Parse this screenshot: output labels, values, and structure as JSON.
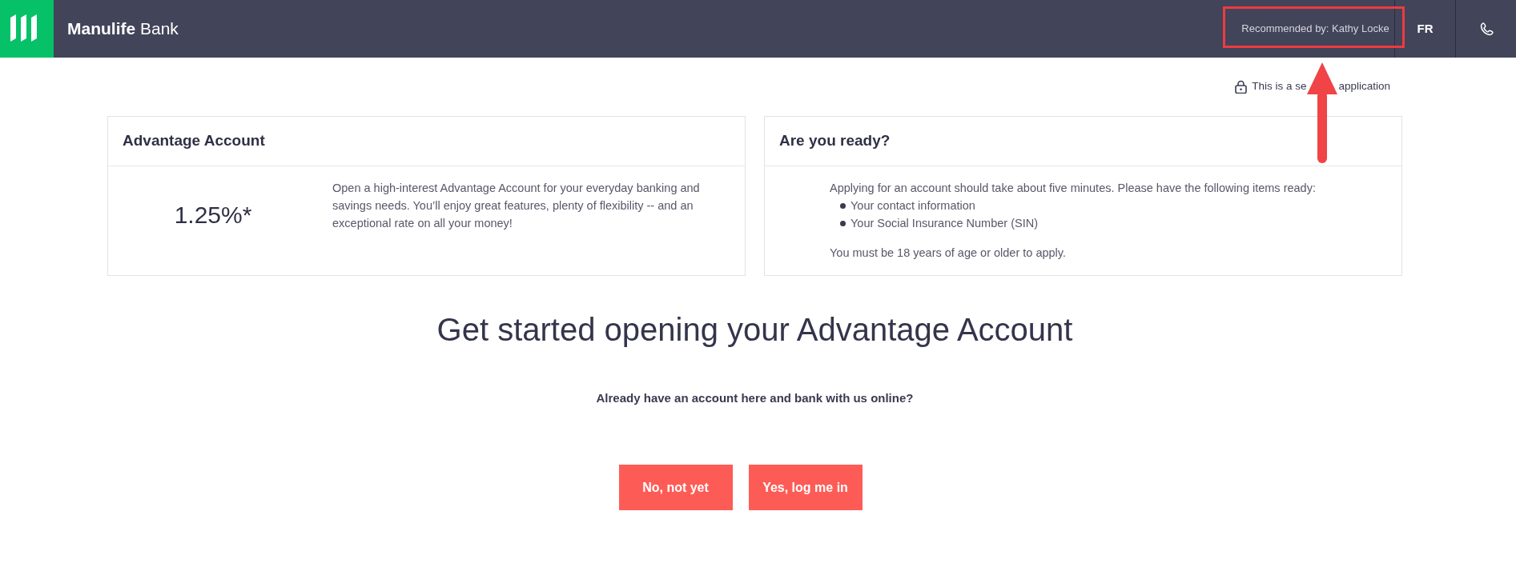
{
  "header": {
    "brand": "**Manulife** Bank",
    "recommended_by": "Recommended by: Kathy Locke",
    "language_link": "FR"
  },
  "secure_note": {
    "text_parts": [
      "This is a se",
      "application"
    ]
  },
  "cards": [
    {
      "kind": "rate",
      "title": "Advantage Account",
      "rate": "1.25%*",
      "description": "Open a high-interest Advantage Account for your everyday banking and savings needs. You’ll enjoy great features, plenty of flexibility -- and an exceptional rate on all your money!"
    },
    {
      "kind": "checklist",
      "title": "Are you ready?",
      "intro": "Applying for an account should take about five minutes. Please have the following items ready:",
      "items": [
        "Your contact information",
        "Your Social Insurance Number (SIN)"
      ],
      "note": "You must be 18 years of age or older to apply."
    }
  ],
  "heading": "Get started opening your Advantage Account",
  "question": "Already have an account here and bank with us online?",
  "buttons": [
    "No, not yet",
    "Yes, log me in"
  ]
}
